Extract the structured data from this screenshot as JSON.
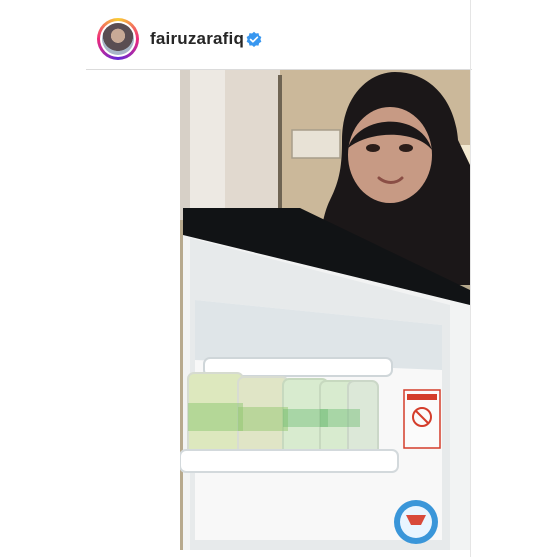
{
  "post": {
    "username": "fairuzarafiq",
    "verified": true,
    "avatar_icon": "profile-avatar",
    "verified_icon": "verified-badge-icon",
    "photo_icon": "post-photo"
  },
  "colors": {
    "username": "#262626",
    "verified_badge": "#3897f0",
    "divider": "#dbdbdb",
    "story_ring": [
      "#f9ce34",
      "#ee2a7b",
      "#6228d7"
    ]
  }
}
